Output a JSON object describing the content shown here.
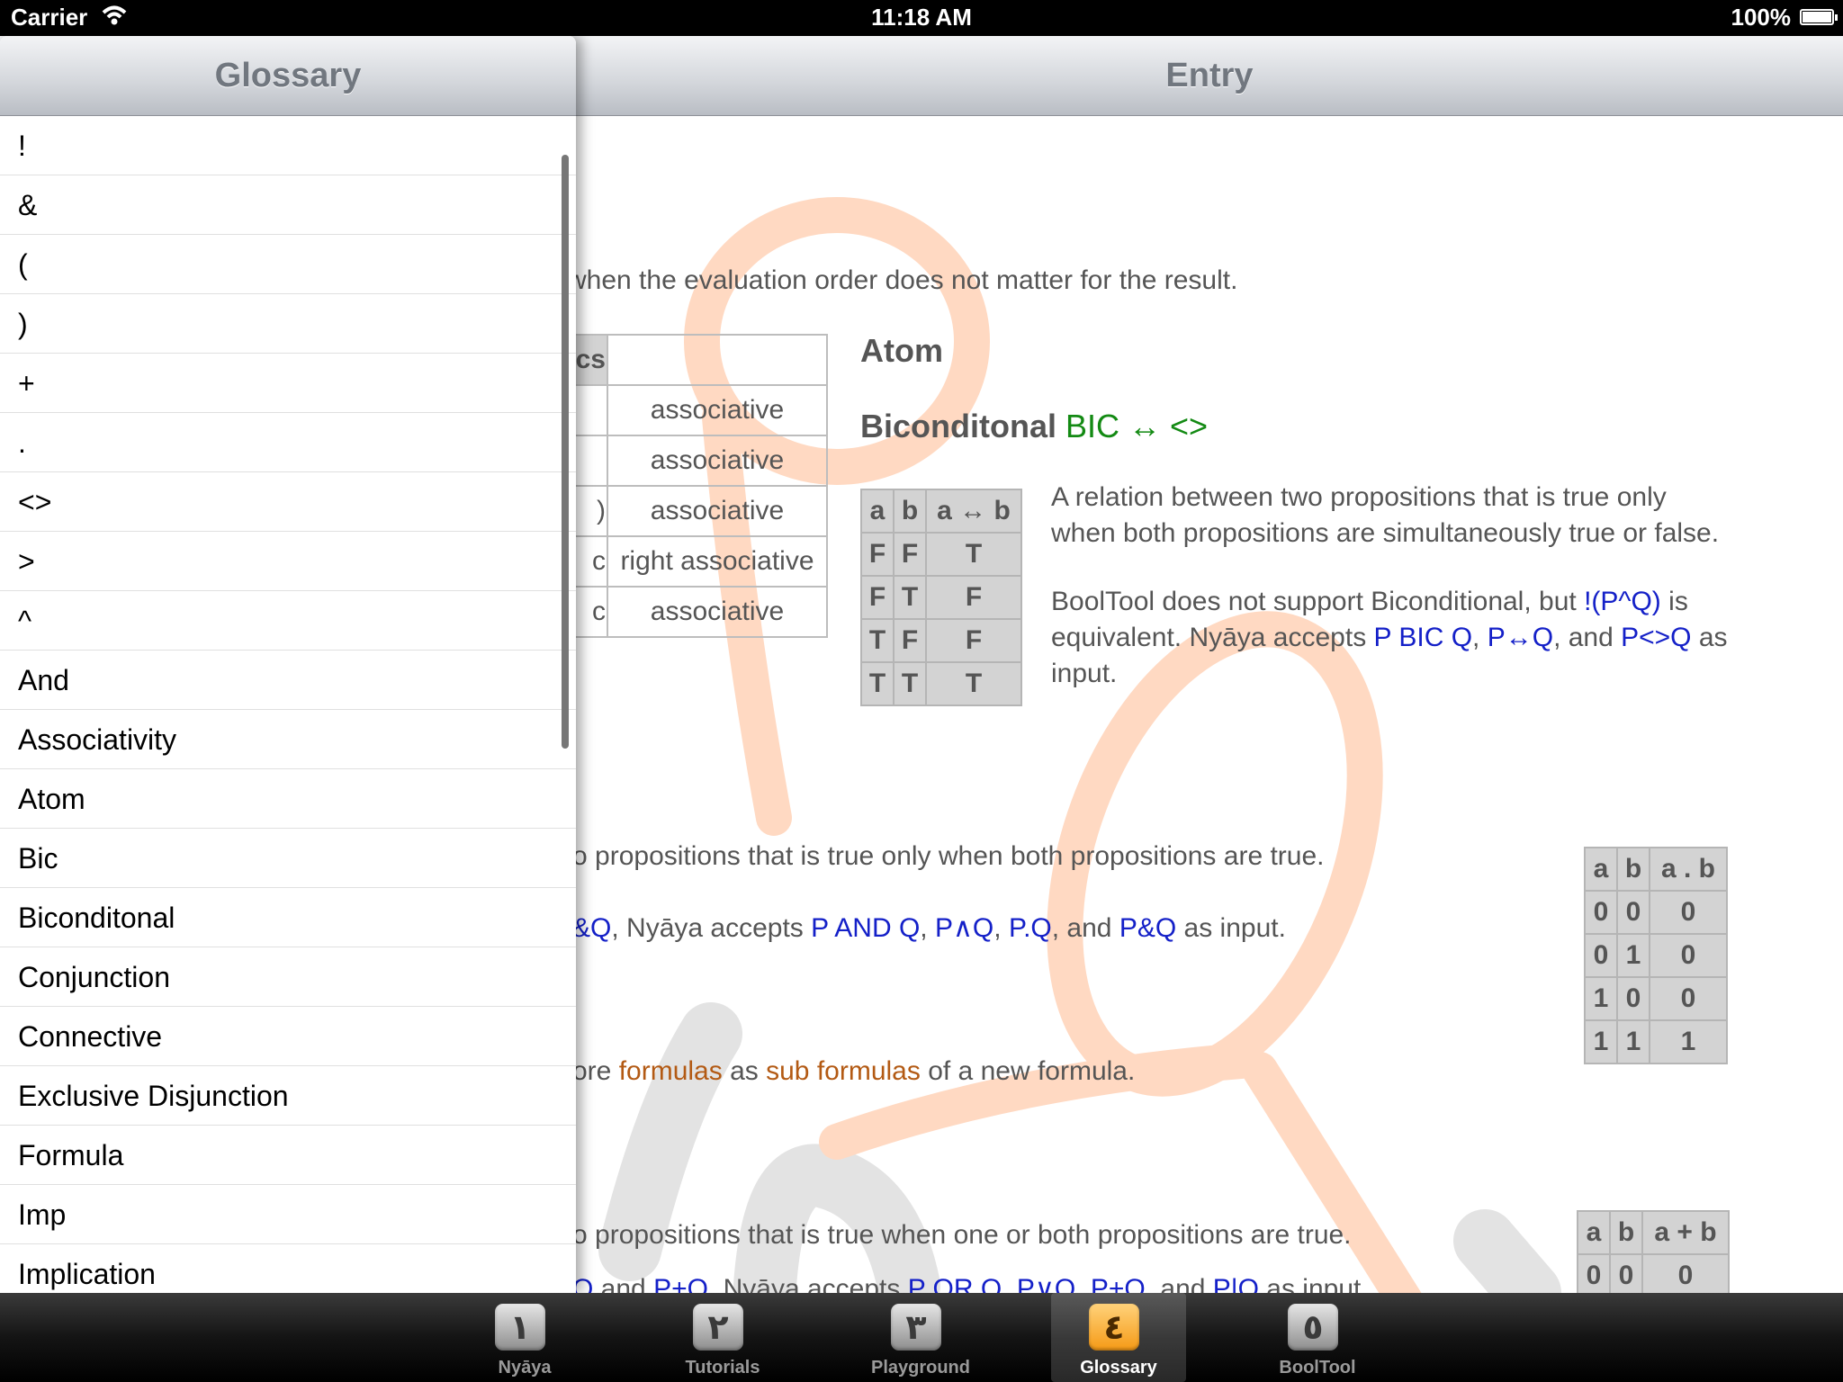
{
  "status": {
    "carrier": "Carrier",
    "time": "11:18 AM",
    "battery": "100%"
  },
  "nav": {
    "title": "Entry"
  },
  "glossary": {
    "title": "Glossary",
    "items": [
      "!",
      "&",
      "(",
      ")",
      "+",
      ".",
      "<>",
      ">",
      "^",
      "And",
      "Associativity",
      "Atom",
      "Bic",
      "Biconditonal",
      "Conjunction",
      "Connective",
      "Exclusive Disjunction",
      "Formula",
      "Imp",
      "Implication"
    ]
  },
  "entry": {
    "assoc_line": "when the evaluation order does not matter for the result.",
    "prec_header": "cs",
    "prec_rows": [
      {
        "left": "",
        "right": "associative"
      },
      {
        "left": "",
        "right": "associative"
      },
      {
        "left": ")",
        "right": "associative"
      },
      {
        "left": "c",
        "right": "right associative"
      },
      {
        "left": "c",
        "right": "associative"
      }
    ],
    "atom_title": "Atom",
    "bic_title": "Biconditonal",
    "bic_symbols": "BIC ↔ <>",
    "bic_table": {
      "headers": [
        "a",
        "b",
        "a ↔ b"
      ],
      "rows": [
        [
          "F",
          "F",
          "T"
        ],
        [
          "F",
          "T",
          "F"
        ],
        [
          "T",
          "F",
          "F"
        ],
        [
          "T",
          "T",
          "T"
        ]
      ]
    },
    "bic_desc": "A relation between two propositions that is true only when both propositions are simultaneously true or false.",
    "bic_note": {
      "p1": "BoolTool does not support Biconditional, but ",
      "c1": "!(P^Q)",
      "p2": " is equivalent. Nyāya accepts ",
      "c2": "P BIC Q",
      "p3": ", ",
      "c3": "P↔Q",
      "p4": ", and ",
      "c4": "P<>Q",
      "p5": " as input."
    },
    "conj_desc": "o propositions that is true only when both propositions are true.",
    "conj_input": {
      "c0": "&Q",
      "p1": ", Nyāya accepts ",
      "c1": "P AND Q",
      "p2": ", ",
      "c2": "P∧Q",
      "p3": ", ",
      "c3": "P.Q",
      "p4": ", and ",
      "c4": "P&Q",
      "p5": " as input."
    },
    "conj_table": {
      "headers": [
        "a",
        "b",
        "a . b"
      ],
      "rows": [
        [
          "0",
          "0",
          "0"
        ],
        [
          "0",
          "1",
          "0"
        ],
        [
          "1",
          "0",
          "0"
        ],
        [
          "1",
          "1",
          "1"
        ]
      ]
    },
    "conn": {
      "p1": "ore ",
      "w1": "formulas",
      "p2": " as ",
      "w2": "sub formulas",
      "p3": " of a new formula."
    },
    "disj_desc": "o propositions that is true when one or both propositions are true.",
    "disj_input": {
      "c0": "Q",
      "p1": " and ",
      "c1": "P+Q",
      "p2": ". Nyāya accepts ",
      "c2": "P OR Q",
      "p3": ", ",
      "c3": "P∨Q",
      "p4": ", ",
      "c4": "P+Q",
      "p5": ", and ",
      "c5": "P|Q",
      "p6": " as input."
    },
    "disj_table": {
      "headers": [
        "a",
        "b",
        "a + b"
      ],
      "rows": [
        [
          "0",
          "0",
          "0"
        ]
      ]
    }
  },
  "tabs": [
    {
      "glyph": "١",
      "label": "Nyāya"
    },
    {
      "glyph": "٢",
      "label": "Tutorials"
    },
    {
      "glyph": "٣",
      "label": "Playground"
    },
    {
      "glyph": "٤",
      "label": "Glossary",
      "selected": true
    },
    {
      "glyph": "٥",
      "label": "BoolTool"
    }
  ],
  "colors": {
    "accent_link": "#1420c8",
    "term_link": "#b35a14",
    "symbol_green": "#138a13",
    "watermark": "#ffd9c2"
  }
}
